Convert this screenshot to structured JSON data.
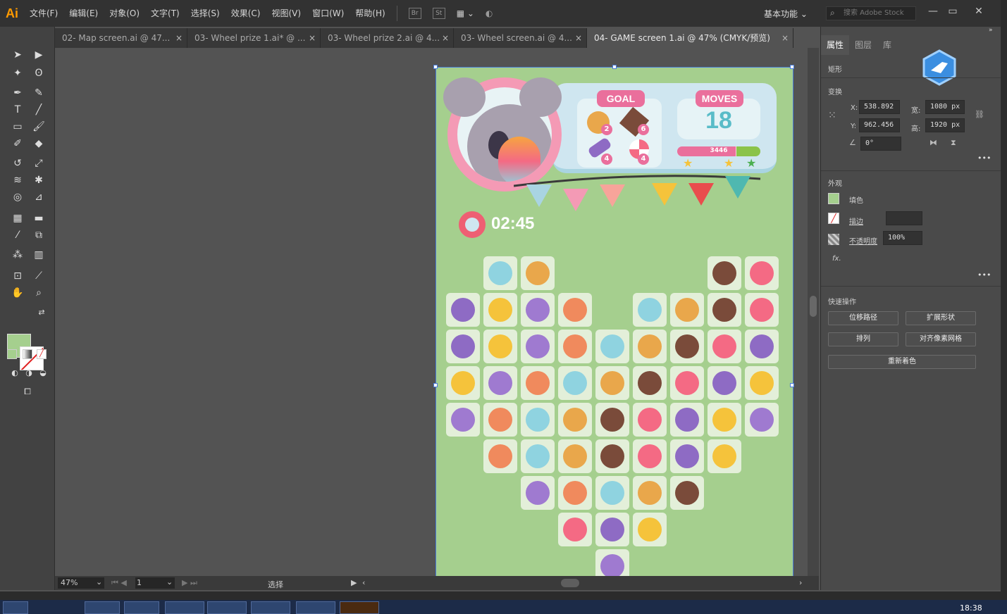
{
  "app": {
    "logo": "Ai"
  },
  "menus": [
    "文件(F)",
    "编辑(E)",
    "对象(O)",
    "文字(T)",
    "选择(S)",
    "效果(C)",
    "视图(V)",
    "窗口(W)",
    "帮助(H)"
  ],
  "menubar_icons": {
    "br": "Br",
    "st": "St"
  },
  "workspace": {
    "label": "基本功能"
  },
  "search": {
    "placeholder": "搜索 Adobe Stock"
  },
  "tabs": [
    {
      "label": "02- Map screen.ai @ 47..."
    },
    {
      "label": "03- Wheel prize 1.ai* @ ..."
    },
    {
      "label": "03- Wheel prize 2.ai @ 4..."
    },
    {
      "label": "03- Wheel screen.ai @ 4..."
    },
    {
      "label": "04- GAME screen 1.ai @ 47% (CMYK/预览)"
    }
  ],
  "game": {
    "goal_title": "GOAL",
    "moves_title": "MOVES",
    "moves_value": "18",
    "score": "3446",
    "score_progress": 0.7,
    "timer": "02:45",
    "goal_counts": [
      "2",
      "6",
      "4",
      "4"
    ]
  },
  "status": {
    "zoom": "47%",
    "page": "1",
    "tool": "选择"
  },
  "panel": {
    "tabs": [
      "属性",
      "图层",
      "库"
    ],
    "object_type": "矩形",
    "transform_label": "变换",
    "x_label": "X:",
    "x": "538.892",
    "y_label": "Y:",
    "y": "962.456",
    "w_label": "宽:",
    "w": "1080 px",
    "h_label": "高:",
    "h": "1920 px",
    "angle": "0°",
    "appearance_label": "外观",
    "fill_label": "填色",
    "stroke_label": "描边",
    "opacity_label": "不透明度",
    "opacity": "100%",
    "fx_label": "fx.",
    "quick_label": "快速操作",
    "btn_offset": "位移路径",
    "btn_expand": "扩展形状",
    "btn_arrange": "排列",
    "btn_align": "对齐像素网格",
    "btn_recolor": "重新着色"
  },
  "clock": "18:38",
  "colors": {
    "artboard": "#a5cf8e",
    "accent_pink": "#ea6f9c",
    "moves_blue": "#59bcc8"
  }
}
